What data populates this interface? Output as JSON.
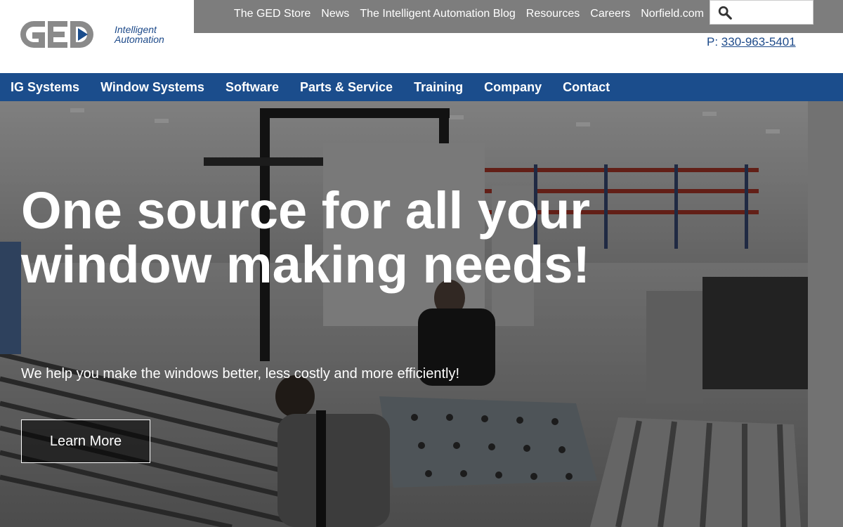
{
  "brand": {
    "logo_text": "GED",
    "tagline_line1": "Intelligent",
    "tagline_line2": "Automation",
    "primary_color": "#1b4d8c",
    "logo_gray": "#8a8a8a"
  },
  "utility_nav": {
    "links": [
      "The GED Store",
      "News",
      "The Intelligent Automation Blog",
      "Resources",
      "Careers",
      "Norfield.com"
    ],
    "search": {
      "icon": "search-icon",
      "placeholder": ""
    }
  },
  "phone": {
    "prefix": "P:",
    "number": "330-963-5401"
  },
  "main_nav": {
    "items": [
      "IG Systems",
      "Window Systems",
      "Software",
      "Parts & Service",
      "Training",
      "Company",
      "Contact"
    ]
  },
  "hero": {
    "title": "One source for all your window making needs!",
    "subtitle": "We help you make the windows better, less costly and more efficiently!",
    "button_label": "Learn More"
  }
}
